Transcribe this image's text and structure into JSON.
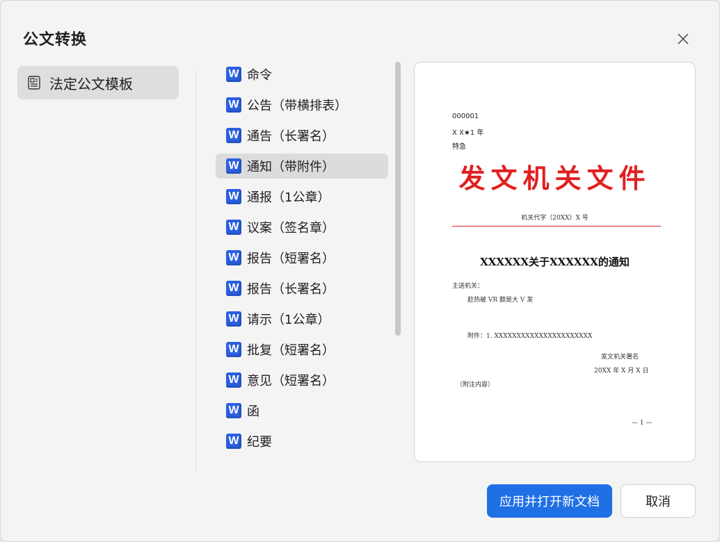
{
  "dialog": {
    "title": "公文转换",
    "close_icon": "close-icon"
  },
  "category": {
    "label": "法定公文模板",
    "icon": "document-template-icon"
  },
  "templates": [
    {
      "label": "命令",
      "icon": "word-icon",
      "selected": false
    },
    {
      "label": "公告（带横排表）",
      "icon": "word-icon",
      "selected": false
    },
    {
      "label": "通告（长署名）",
      "icon": "word-icon",
      "selected": false
    },
    {
      "label": "通知（带附件）",
      "icon": "word-icon",
      "selected": true
    },
    {
      "label": "通报（1公章）",
      "icon": "word-icon",
      "selected": false
    },
    {
      "label": "议案（签名章）",
      "icon": "word-icon",
      "selected": false
    },
    {
      "label": "报告（短署名）",
      "icon": "word-icon",
      "selected": false
    },
    {
      "label": "报告（长署名）",
      "icon": "word-icon",
      "selected": false
    },
    {
      "label": "请示（1公章）",
      "icon": "word-icon",
      "selected": false
    },
    {
      "label": "批复（短署名）",
      "icon": "word-icon",
      "selected": false
    },
    {
      "label": "意见（短署名）",
      "icon": "word-icon",
      "selected": false
    },
    {
      "label": "函",
      "icon": "word-icon",
      "selected": false
    },
    {
      "label": "纪要",
      "icon": "word-icon",
      "selected": false
    }
  ],
  "word_icon_letter": "W",
  "preview": {
    "serial": "000001",
    "secret": "X X★1 年",
    "urgency": "特急",
    "issuer": "发文机关文件",
    "doc_number": "机关代字（20XX）X 号",
    "doc_title": "XXXXXX关于XXXXXX的通知",
    "recipient_label": "主送机关：",
    "body": "趁热被 VR 额是大 V 发",
    "attachment": "附件：1. XXXXXXXXXXXXXXXXXXXXXX",
    "signature": "发文机关署名",
    "date": "20XX 年 X 月 X 日",
    "note": "（附注内容）",
    "page_number": "— 1 —"
  },
  "colors": {
    "primary": "#1f6fe5",
    "issuer_red": "#e02020",
    "word_blue": "#2b5fe0"
  },
  "buttons": {
    "apply": "应用并打开新文档",
    "cancel": "取消"
  }
}
